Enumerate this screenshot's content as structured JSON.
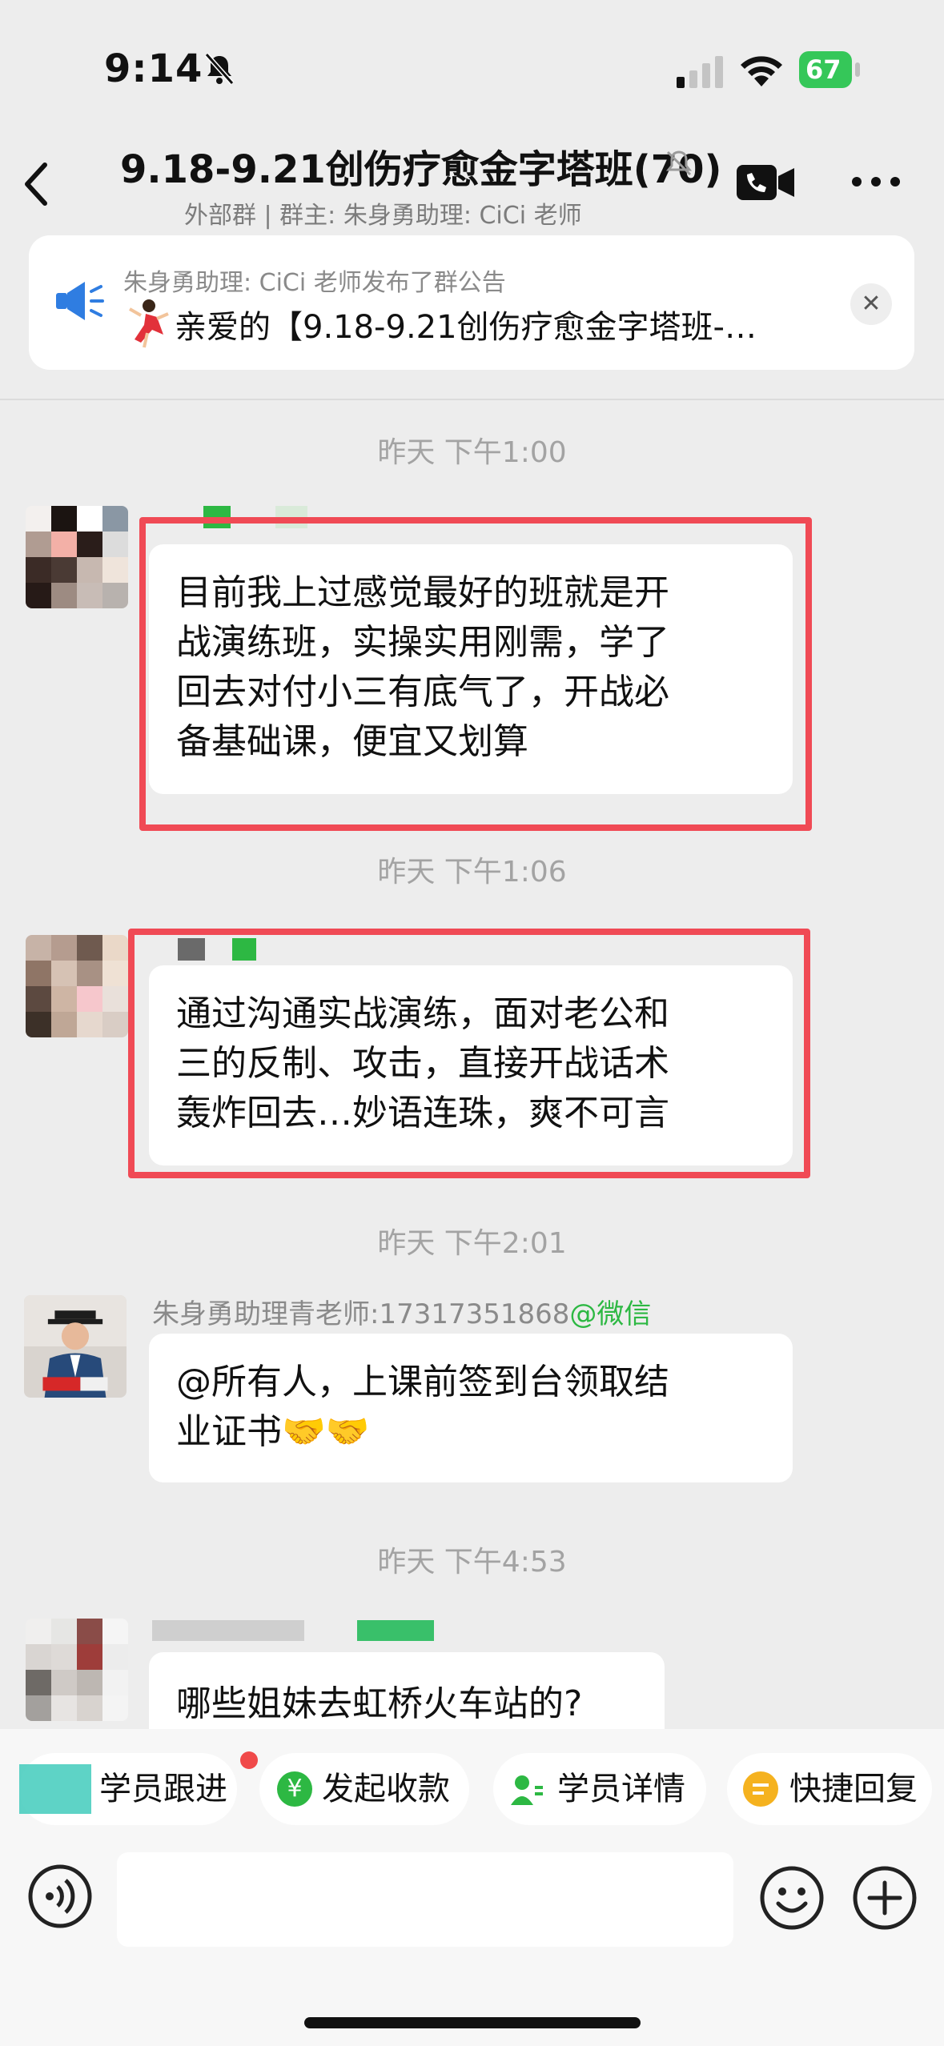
{
  "status_bar": {
    "time": "9:14",
    "battery": "67"
  },
  "header": {
    "title": "9.18-9.21创伤疗愈金字塔班(70)",
    "subtitle": "外部群 | 群主: 朱身勇助理: CiCi 老师"
  },
  "announcement": {
    "title": "朱身勇助理: CiCi 老师发布了群公告",
    "body": "亲爱的【9.18-9.21创伤疗愈金字塔班-…"
  },
  "messages": [
    {
      "time": "昨天 下午1:00",
      "lines": [
        "目前我上过感觉最好的班就是开",
        "战演练班，实操实用刚需，学了",
        "回去对付小三有底气了，开战必",
        "备基础课，便宜又划算"
      ]
    },
    {
      "time": "昨天 下午1:06",
      "lines": [
        "通过沟通实战演练，面对老公和",
        "三的反制、攻击，直接开战话术",
        "轰炸回去…妙语连珠，爽不可言"
      ]
    },
    {
      "time": "昨天 下午2:01",
      "sender": "朱身勇助理青老师:17317351868",
      "sender_suffix": "@微信",
      "lines": [
        "@所有人，上课前签到台领取结",
        "业证书🤝🤝"
      ]
    },
    {
      "time": "昨天 下午4:53",
      "lines": [
        "哪些姐妹去虹桥火车站的?"
      ]
    }
  ],
  "quick_actions": [
    "学员跟进",
    "发起收款",
    "学员详情",
    "快捷回复"
  ],
  "colors": {
    "highlight_border": "#f04a55",
    "wechat_green": "#2db843",
    "battery_green": "#35c759"
  },
  "icons": [
    "bell-slash-icon",
    "signal-icon",
    "wifi-icon",
    "back-icon",
    "mute-icon",
    "video-call-icon",
    "more-icon",
    "speaker-icon",
    "close-icon",
    "voice-icon",
    "emoji-icon",
    "plus-icon"
  ]
}
